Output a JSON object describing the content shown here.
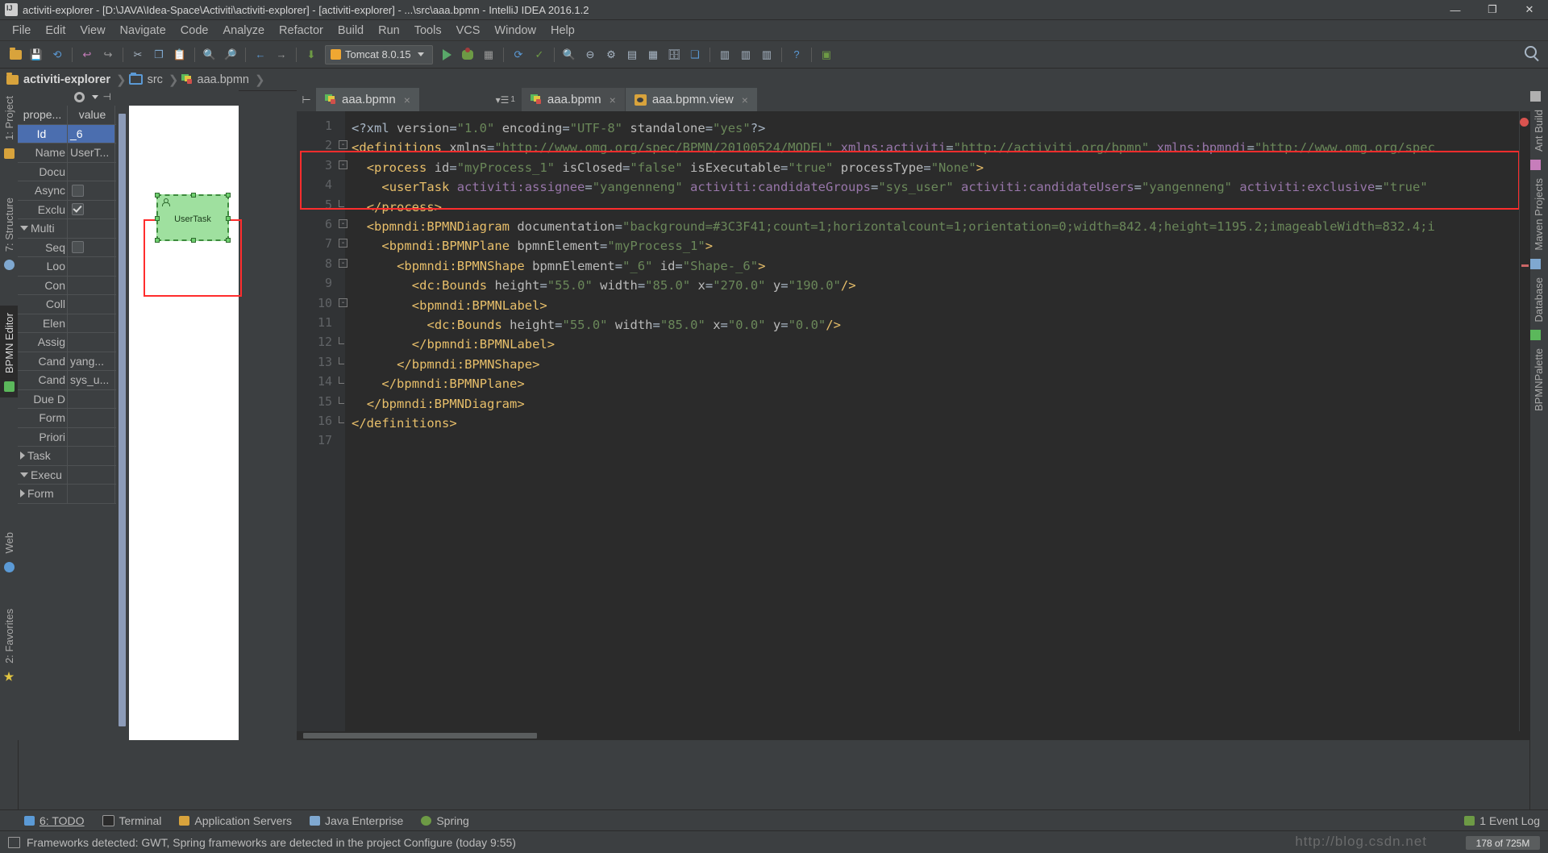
{
  "window": {
    "title": "activiti-explorer - [D:\\JAVA\\Idea-Space\\Activiti\\activiti-explorer] - [activiti-explorer] - ...\\src\\aaa.bpmn - IntelliJ IDEA 2016.1.2",
    "minimize": "—",
    "maximize": "❐",
    "close": "✕"
  },
  "menu": [
    "File",
    "Edit",
    "View",
    "Navigate",
    "Code",
    "Analyze",
    "Refactor",
    "Build",
    "Run",
    "Tools",
    "VCS",
    "Window",
    "Help"
  ],
  "toolbar": {
    "run_config": "Tomcat 8.0.15",
    "search_icon": "search-icon"
  },
  "breadcrumb": [
    {
      "label": "activiti-explorer",
      "icon": "module-folder-icon"
    },
    {
      "label": "src",
      "icon": "source-folder-icon"
    },
    {
      "label": "aaa.bpmn",
      "icon": "bpmn-file-icon"
    }
  ],
  "left_stripe": [
    {
      "label": "1: Project"
    },
    {
      "label": "7: Structure"
    },
    {
      "label": "BPMN Editor"
    },
    {
      "label": "Web"
    },
    {
      "label": "2: Favorites"
    }
  ],
  "right_stripe": [
    {
      "label": "Ant Build"
    },
    {
      "label": "Maven Projects"
    },
    {
      "label": "Database"
    },
    {
      "label": "BPMNPalette"
    }
  ],
  "properties": {
    "header": {
      "gear": "gear-icon",
      "hide": "hide-icon"
    },
    "columns": [
      "prope...",
      "value"
    ],
    "rows": [
      {
        "key": "Id",
        "value": "_6",
        "type": "text",
        "selected": true
      },
      {
        "key": "Name",
        "value": "UserT...",
        "type": "text"
      },
      {
        "key": "Docu",
        "value": "",
        "type": "text"
      },
      {
        "key": "Async",
        "value": "",
        "type": "checkbox",
        "checked": false
      },
      {
        "key": "Exclu",
        "value": "",
        "type": "checkbox",
        "checked": true
      },
      {
        "key": "Multi",
        "value": "",
        "type": "group",
        "expanded": true
      },
      {
        "key": "Seq",
        "value": "",
        "type": "checkbox",
        "checked": false
      },
      {
        "key": "Loo",
        "value": "",
        "type": "text"
      },
      {
        "key": "Con",
        "value": "",
        "type": "text"
      },
      {
        "key": "Coll",
        "value": "",
        "type": "text"
      },
      {
        "key": "Elen",
        "value": "",
        "type": "text"
      },
      {
        "key": "Assig",
        "value": "",
        "type": "text"
      },
      {
        "key": "Cand",
        "value": "yang...",
        "type": "text"
      },
      {
        "key": "Cand",
        "value": "sys_u...",
        "type": "text"
      },
      {
        "key": "Due D",
        "value": "",
        "type": "text"
      },
      {
        "key": "Form",
        "value": "",
        "type": "text"
      },
      {
        "key": "Priori",
        "value": "",
        "type": "text"
      },
      {
        "key": "Task ",
        "value": "",
        "type": "group",
        "expanded": false
      },
      {
        "key": "Execu",
        "value": "",
        "type": "group",
        "expanded": true
      },
      {
        "key": "Form",
        "value": "",
        "type": "group",
        "expanded": false
      }
    ]
  },
  "diagram": {
    "node_label": "UserTask",
    "node_icon": "user-task-icon",
    "selection_color": "#ff2d2d"
  },
  "editor": {
    "tabs": [
      {
        "label": "aaa.bpmn",
        "icon": "bpmn-file-icon",
        "close": "×",
        "state": "active-left"
      },
      {
        "label": "aaa.bpmn",
        "icon": "bpmn-file-icon",
        "close": "×",
        "state": "inactive"
      },
      {
        "label": "aaa.bpmn.view",
        "icon": "view-file-icon",
        "close": "×",
        "state": "selected"
      }
    ],
    "tab_list_icon": "tab-list-icon",
    "tab_list_count": "1",
    "line_numbers": [
      "1",
      "2",
      "3",
      "4",
      "5",
      "6",
      "7",
      "8",
      "9",
      "10",
      "11",
      "12",
      "13",
      "14",
      "15",
      "16",
      "17"
    ],
    "code_lines": [
      {
        "n": 1,
        "indent": 0,
        "segments": [
          {
            "t": "<?xml ",
            "c": "k-pi"
          },
          {
            "t": "version",
            "c": "k-attr"
          },
          {
            "t": "=",
            "c": "k-eq"
          },
          {
            "t": "\"1.0\"",
            "c": "k-str"
          },
          {
            "t": " ",
            "c": "k-attr"
          },
          {
            "t": "encoding",
            "c": "k-attr"
          },
          {
            "t": "=",
            "c": "k-eq"
          },
          {
            "t": "\"UTF-8\"",
            "c": "k-str"
          },
          {
            "t": " ",
            "c": "k-attr"
          },
          {
            "t": "standalone",
            "c": "k-attr"
          },
          {
            "t": "=",
            "c": "k-eq"
          },
          {
            "t": "\"yes\"",
            "c": "k-str"
          },
          {
            "t": "?>",
            "c": "k-pi"
          }
        ]
      },
      {
        "n": 2,
        "indent": 0,
        "segments": [
          {
            "t": "<definitions ",
            "c": "k-tag"
          },
          {
            "t": "xmlns",
            "c": "k-attr"
          },
          {
            "t": "=",
            "c": "k-eq"
          },
          {
            "t": "\"http://www.omg.org/spec/BPMN/20100524/MODEL\"",
            "c": "k-str"
          },
          {
            "t": " ",
            "c": "k-attr"
          },
          {
            "t": "xmlns:activiti",
            "c": "k-ns"
          },
          {
            "t": "=",
            "c": "k-eq"
          },
          {
            "t": "\"http://activiti.org/bpmn\"",
            "c": "k-str"
          },
          {
            "t": " ",
            "c": "k-attr"
          },
          {
            "t": "xmlns:bpmndi",
            "c": "k-ns"
          },
          {
            "t": "=",
            "c": "k-eq"
          },
          {
            "t": "\"http://www.omg.org/spec",
            "c": "k-str"
          }
        ]
      },
      {
        "n": 3,
        "indent": 1,
        "segments": [
          {
            "t": "<process ",
            "c": "k-tag"
          },
          {
            "t": "id",
            "c": "k-attr"
          },
          {
            "t": "=",
            "c": "k-eq"
          },
          {
            "t": "\"myProcess_1\"",
            "c": "k-str"
          },
          {
            "t": " ",
            "c": "k-attr"
          },
          {
            "t": "isClosed",
            "c": "k-attr"
          },
          {
            "t": "=",
            "c": "k-eq"
          },
          {
            "t": "\"false\"",
            "c": "k-str"
          },
          {
            "t": " ",
            "c": "k-attr"
          },
          {
            "t": "isExecutable",
            "c": "k-attr"
          },
          {
            "t": "=",
            "c": "k-eq"
          },
          {
            "t": "\"true\"",
            "c": "k-str"
          },
          {
            "t": " ",
            "c": "k-attr"
          },
          {
            "t": "processType",
            "c": "k-attr"
          },
          {
            "t": "=",
            "c": "k-eq"
          },
          {
            "t": "\"None\"",
            "c": "k-str"
          },
          {
            "t": ">",
            "c": "k-tag"
          }
        ]
      },
      {
        "n": 4,
        "indent": 2,
        "segments": [
          {
            "t": "<userTask ",
            "c": "k-tag"
          },
          {
            "t": "activiti:assignee",
            "c": "k-ns"
          },
          {
            "t": "=",
            "c": "k-eq"
          },
          {
            "t": "\"yangenneng\"",
            "c": "k-str"
          },
          {
            "t": " ",
            "c": "k-attr"
          },
          {
            "t": "activiti:candidateGroups",
            "c": "k-ns"
          },
          {
            "t": "=",
            "c": "k-eq"
          },
          {
            "t": "\"sys_user\"",
            "c": "k-str"
          },
          {
            "t": " ",
            "c": "k-attr"
          },
          {
            "t": "activiti:candidateUsers",
            "c": "k-ns"
          },
          {
            "t": "=",
            "c": "k-eq"
          },
          {
            "t": "\"yangenneng\"",
            "c": "k-str"
          },
          {
            "t": " ",
            "c": "k-attr"
          },
          {
            "t": "activiti:exclusive",
            "c": "k-ns"
          },
          {
            "t": "=",
            "c": "k-eq"
          },
          {
            "t": "\"true\"",
            "c": "k-str"
          }
        ]
      },
      {
        "n": 5,
        "indent": 1,
        "segments": [
          {
            "t": "</process>",
            "c": "k-tag"
          }
        ]
      },
      {
        "n": 6,
        "indent": 1,
        "segments": [
          {
            "t": "<bpmndi:BPMNDiagram ",
            "c": "k-tag"
          },
          {
            "t": "documentation",
            "c": "k-attr"
          },
          {
            "t": "=",
            "c": "k-eq"
          },
          {
            "t": "\"background=#3C3F41;count=1;horizontalcount=1;orientation=0;width=842.4;height=1195.2;imageableWidth=832.4;i",
            "c": "k-str"
          }
        ]
      },
      {
        "n": 7,
        "indent": 2,
        "segments": [
          {
            "t": "<bpmndi:BPMNPlane ",
            "c": "k-tag"
          },
          {
            "t": "bpmnElement",
            "c": "k-attr"
          },
          {
            "t": "=",
            "c": "k-eq"
          },
          {
            "t": "\"myProcess_1\"",
            "c": "k-str"
          },
          {
            "t": ">",
            "c": "k-tag"
          }
        ]
      },
      {
        "n": 8,
        "indent": 3,
        "segments": [
          {
            "t": "<bpmndi:BPMNShape ",
            "c": "k-tag"
          },
          {
            "t": "bpmnElement",
            "c": "k-attr"
          },
          {
            "t": "=",
            "c": "k-eq"
          },
          {
            "t": "\"_6\"",
            "c": "k-str"
          },
          {
            "t": " ",
            "c": "k-attr"
          },
          {
            "t": "id",
            "c": "k-attr"
          },
          {
            "t": "=",
            "c": "k-eq"
          },
          {
            "t": "\"Shape-_6\"",
            "c": "k-str"
          },
          {
            "t": ">",
            "c": "k-tag"
          }
        ]
      },
      {
        "n": 9,
        "indent": 4,
        "segments": [
          {
            "t": "<dc:Bounds ",
            "c": "k-tag"
          },
          {
            "t": "height",
            "c": "k-attr"
          },
          {
            "t": "=",
            "c": "k-eq"
          },
          {
            "t": "\"55.0\"",
            "c": "k-str"
          },
          {
            "t": " ",
            "c": "k-attr"
          },
          {
            "t": "width",
            "c": "k-attr"
          },
          {
            "t": "=",
            "c": "k-eq"
          },
          {
            "t": "\"85.0\"",
            "c": "k-str"
          },
          {
            "t": " ",
            "c": "k-attr"
          },
          {
            "t": "x",
            "c": "k-attr"
          },
          {
            "t": "=",
            "c": "k-eq"
          },
          {
            "t": "\"270.0\"",
            "c": "k-str"
          },
          {
            "t": " ",
            "c": "k-attr"
          },
          {
            "t": "y",
            "c": "k-attr"
          },
          {
            "t": "=",
            "c": "k-eq"
          },
          {
            "t": "\"190.0\"",
            "c": "k-str"
          },
          {
            "t": "/>",
            "c": "k-tag"
          }
        ]
      },
      {
        "n": 10,
        "indent": 4,
        "segments": [
          {
            "t": "<bpmndi:BPMNLabel>",
            "c": "k-tag"
          }
        ]
      },
      {
        "n": 11,
        "indent": 5,
        "segments": [
          {
            "t": "<dc:Bounds ",
            "c": "k-tag"
          },
          {
            "t": "height",
            "c": "k-attr"
          },
          {
            "t": "=",
            "c": "k-eq"
          },
          {
            "t": "\"55.0\"",
            "c": "k-str"
          },
          {
            "t": " ",
            "c": "k-attr"
          },
          {
            "t": "width",
            "c": "k-attr"
          },
          {
            "t": "=",
            "c": "k-eq"
          },
          {
            "t": "\"85.0\"",
            "c": "k-str"
          },
          {
            "t": " ",
            "c": "k-attr"
          },
          {
            "t": "x",
            "c": "k-attr"
          },
          {
            "t": "=",
            "c": "k-eq"
          },
          {
            "t": "\"0.0\"",
            "c": "k-str"
          },
          {
            "t": " ",
            "c": "k-attr"
          },
          {
            "t": "y",
            "c": "k-attr"
          },
          {
            "t": "=",
            "c": "k-eq"
          },
          {
            "t": "\"0.0\"",
            "c": "k-str"
          },
          {
            "t": "/>",
            "c": "k-tag"
          }
        ]
      },
      {
        "n": 12,
        "indent": 4,
        "segments": [
          {
            "t": "</bpmndi:BPMNLabel>",
            "c": "k-tag"
          }
        ]
      },
      {
        "n": 13,
        "indent": 3,
        "segments": [
          {
            "t": "</bpmndi:BPMNShape>",
            "c": "k-tag"
          }
        ]
      },
      {
        "n": 14,
        "indent": 2,
        "segments": [
          {
            "t": "</bpmndi:BPMNPlane>",
            "c": "k-tag"
          }
        ]
      },
      {
        "n": 15,
        "indent": 1,
        "segments": [
          {
            "t": "</bpmndi:BPMNDiagram>",
            "c": "k-tag"
          }
        ]
      },
      {
        "n": 16,
        "indent": 0,
        "segments": [
          {
            "t": "</definitions>",
            "c": "k-tag"
          }
        ]
      },
      {
        "n": 17,
        "indent": 0,
        "segments": []
      }
    ],
    "highlight_box_color": "#ff2d2d"
  },
  "bottom_bar": {
    "items": [
      {
        "label": "6: TODO",
        "icon": "todo-icon"
      },
      {
        "label": "Terminal",
        "icon": "terminal-icon"
      },
      {
        "label": "Application Servers",
        "icon": "app-servers-icon"
      },
      {
        "label": "Java Enterprise",
        "icon": "java-enterprise-icon"
      },
      {
        "label": "Spring",
        "icon": "spring-icon"
      }
    ],
    "event_log": "1 Event Log",
    "event_log_icon": "event-log-icon"
  },
  "status": {
    "text": "Frameworks detected: GWT, Spring frameworks are detected in the project Configure (today 9:55)",
    "icon": "info-icon",
    "watermark": "http://blog.csdn.net",
    "memory": "178 of 725M"
  }
}
